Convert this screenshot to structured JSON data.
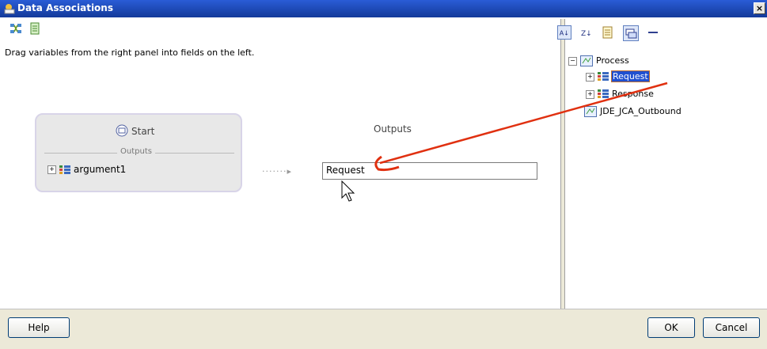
{
  "window": {
    "title": "Data Associations",
    "close_glyph": "×"
  },
  "toolbar": {
    "icons": [
      "map-icon",
      "document-icon"
    ]
  },
  "hint_text": "Drag variables from the right panel into fields on the left.",
  "start_node": {
    "label": "Start",
    "outputs_label": "Outputs",
    "argument": "argument1"
  },
  "outputs": {
    "heading": "Outputs",
    "field_value": "Request",
    "connector": "·······▸"
  },
  "right_toolbar": {
    "icons": [
      "sort-az-icon",
      "sort-za-icon",
      "list-icon",
      "view-toggle-icon",
      "collapse-icon"
    ]
  },
  "tree": {
    "root": "Process",
    "children": [
      "Request",
      "Response"
    ],
    "other": "JDE_JCA_Outbound"
  },
  "buttons": {
    "help": "Help",
    "ok": "OK",
    "cancel": "Cancel"
  },
  "colors": {
    "title_bar": "#1a3fa8",
    "selection": "#2050d0",
    "annotation_arrow": "#e03010"
  }
}
